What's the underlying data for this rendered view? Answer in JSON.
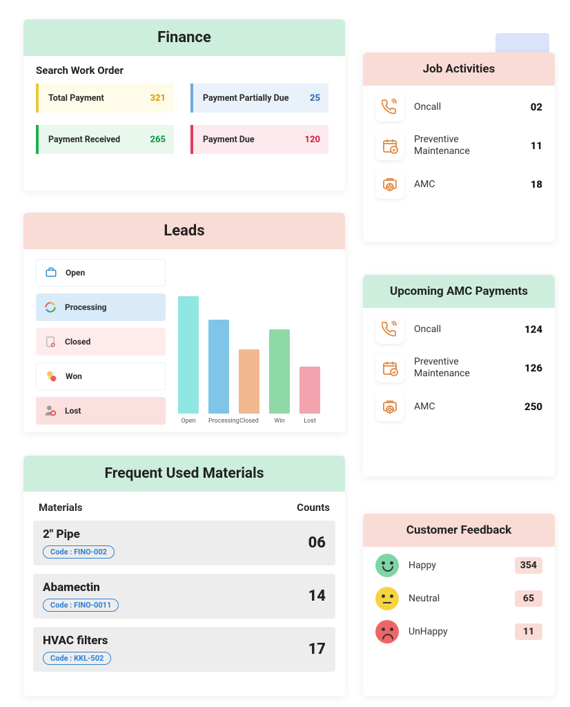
{
  "finance": {
    "title": "Finance",
    "subtitle": "Search Work Order",
    "tiles": [
      {
        "label": "Total Payment",
        "value": "321"
      },
      {
        "label": "Payment Partially Due",
        "value": "25"
      },
      {
        "label": "Payment Received",
        "value": "265"
      },
      {
        "label": "Payment Due",
        "value": "120"
      }
    ]
  },
  "leads": {
    "title": "Leads",
    "statuses": [
      {
        "label": "Open"
      },
      {
        "label": "Processing"
      },
      {
        "label": "Closed"
      },
      {
        "label": "Won"
      },
      {
        "label": "Lost"
      }
    ]
  },
  "chart_data": {
    "type": "bar",
    "title": "Leads",
    "categories": [
      "Open",
      "Processing",
      "Closed",
      "Win",
      "Lost"
    ],
    "values": [
      100,
      80,
      55,
      72,
      40
    ],
    "ylim": [
      0,
      100
    ],
    "colors": [
      "#8fe6e2",
      "#7fc5e8",
      "#f1b990",
      "#8fd9a6",
      "#f2a3ad"
    ]
  },
  "materials": {
    "title": "Frequent Used Materials",
    "col_material": "Materials",
    "col_count": "Counts",
    "code_prefix": "Code : ",
    "rows": [
      {
        "name": "2\" Pipe",
        "code": "FINO-002",
        "count": "06"
      },
      {
        "name": "Abamectin",
        "code": "FINO-0011",
        "count": "14"
      },
      {
        "name": "HVAC filters",
        "code": "KKL-502",
        "count": "17"
      }
    ]
  },
  "job_activities": {
    "title": "Job Activities",
    "rows": [
      {
        "label": "Oncall",
        "value": "02"
      },
      {
        "label": "Preventive Maintenance",
        "value": "11"
      },
      {
        "label": "AMC",
        "value": "18"
      }
    ]
  },
  "amc_payments": {
    "title": "Upcoming AMC Payments",
    "rows": [
      {
        "label": "Oncall",
        "value": "124"
      },
      {
        "label": "Preventive Maintenance",
        "value": "126"
      },
      {
        "label": "AMC",
        "value": "250"
      }
    ]
  },
  "feedback": {
    "title": "Customer Feedback",
    "rows": [
      {
        "label": "Happy",
        "value": "354"
      },
      {
        "label": "Neutral",
        "value": "65"
      },
      {
        "label": "UnHappy",
        "value": "11"
      }
    ]
  }
}
